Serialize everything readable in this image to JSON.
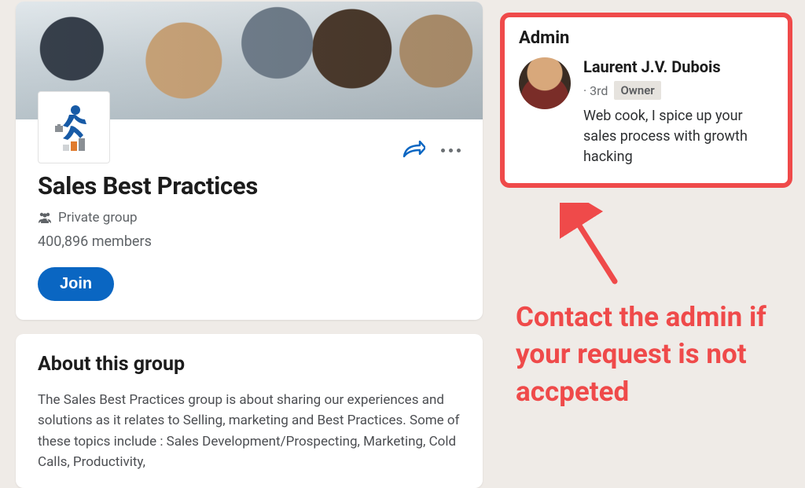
{
  "group": {
    "name": "Sales Best Practices",
    "privacy_label": "Private group",
    "members_label": "400,896 members",
    "join_label": "Join"
  },
  "about": {
    "heading": "About this group",
    "text": "The Sales Best Practices group is about sharing our experiences and solutions as it relates to Selling, marketing and Best Practices. Some of these topics include : Sales Development/Prospecting,  Marketing, Cold Calls, Productivity,"
  },
  "admin": {
    "heading": "Admin",
    "name": "Laurent J.V. Dubois",
    "degree": "· 3rd",
    "role_tag": "Owner",
    "bio": "Web cook, I spice up your sales process with growth hacking"
  },
  "annotation": {
    "callout": "Contact the admin if your request is not accpeted"
  },
  "icons": {
    "share": "share-icon",
    "more": "more-icon",
    "people": "people-icon",
    "logo": "group-logo-icon",
    "arrow": "annotation-arrow"
  }
}
